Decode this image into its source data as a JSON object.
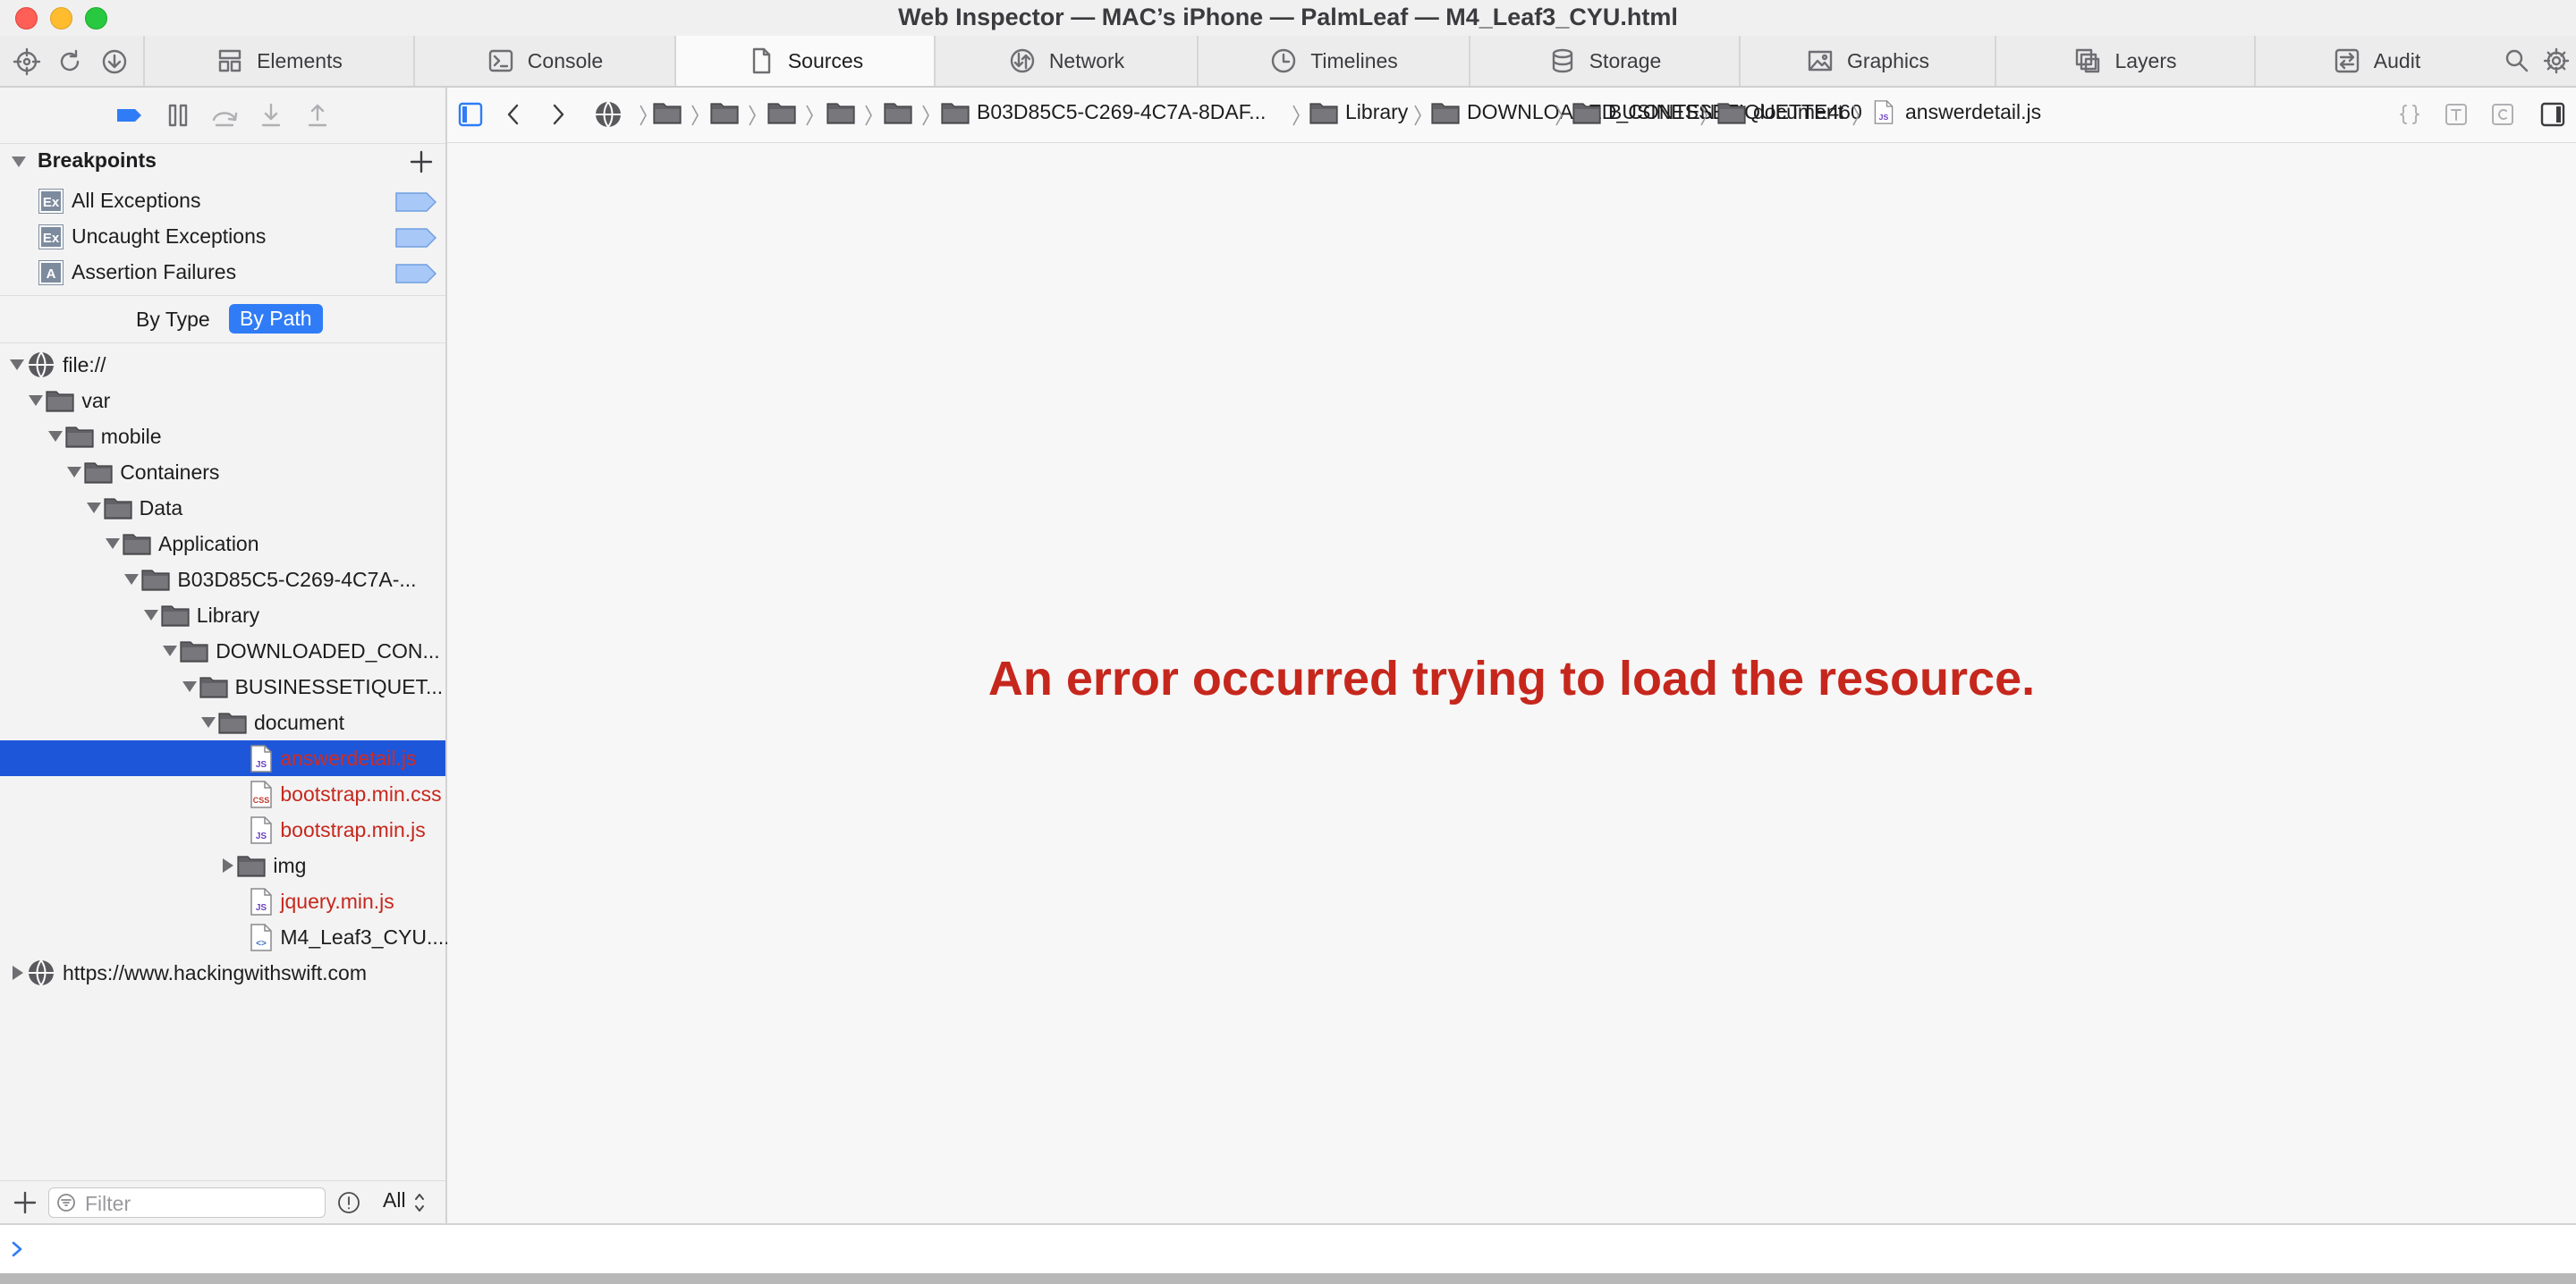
{
  "window": {
    "title": "Web Inspector — MAC’s iPhone — PalmLeaf — M4_Leaf3_CYU.html"
  },
  "tabs": [
    {
      "label": "Elements",
      "icon": "elements-icon"
    },
    {
      "label": "Console",
      "icon": "console-icon"
    },
    {
      "label": "Sources",
      "icon": "document-icon",
      "active": true
    },
    {
      "label": "Network",
      "icon": "network-icon"
    },
    {
      "label": "Timelines",
      "icon": "clock-icon"
    },
    {
      "label": "Storage",
      "icon": "database-icon"
    },
    {
      "label": "Graphics",
      "icon": "image-icon"
    },
    {
      "label": "Layers",
      "icon": "layers-icon"
    },
    {
      "label": "Audit",
      "icon": "audit-icon"
    }
  ],
  "breakpoints": {
    "title": "Breakpoints",
    "items": [
      {
        "label": "All Exceptions",
        "badge": "Ex"
      },
      {
        "label": "Uncaught Exceptions",
        "badge": "Ex"
      },
      {
        "label": "Assertion Failures",
        "badge": "A"
      }
    ]
  },
  "view_toggle": {
    "by_type": "By Type",
    "by_path": "By Path",
    "selected": "By Path"
  },
  "tree": [
    {
      "label": "file://"
    },
    {
      "label": "var"
    },
    {
      "label": "mobile"
    },
    {
      "label": "Containers"
    },
    {
      "label": "Data"
    },
    {
      "label": "Application"
    },
    {
      "label": "B03D85C5-C269-4C7A-..."
    },
    {
      "label": "Library"
    },
    {
      "label": "DOWNLOADED_CON..."
    },
    {
      "label": "BUSINESSETIQUET..."
    },
    {
      "label": "document"
    },
    {
      "label": "answerdetail.js",
      "selected": true
    },
    {
      "label": "bootstrap.min.css"
    },
    {
      "label": "bootstrap.min.js"
    },
    {
      "label": "img"
    },
    {
      "label": "jquery.min.js"
    },
    {
      "label": "M4_Leaf3_CYU...."
    },
    {
      "label": "https://www.hackingwithswift.com"
    }
  ],
  "filter": {
    "placeholder": "Filter",
    "value": "",
    "scope": "All"
  },
  "breadcrumb": {
    "segments": [
      "B03D85C5-C269-4C7A-8DAF...",
      "Library",
      "DOWNLOADED_CONTENT",
      "BUSINESSETIQUETTE460",
      "document",
      "answerdetail.js"
    ]
  },
  "content": {
    "error_message": "An error occurred trying to load the resource."
  },
  "colors": {
    "accent": "#2f7cf6",
    "selection": "#1e56d9",
    "error": "#c6271d",
    "breakpoint_flag": "#a8c8f8"
  }
}
